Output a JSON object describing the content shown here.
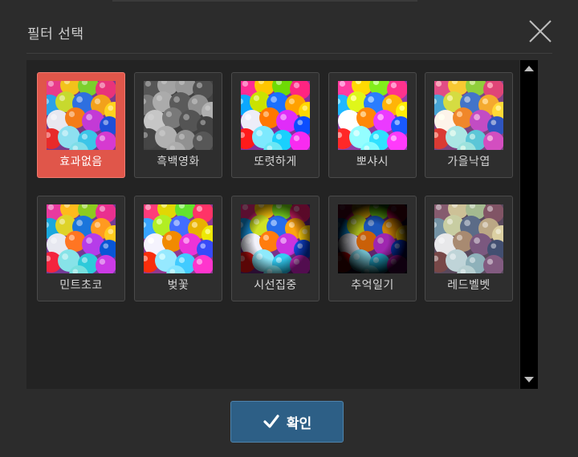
{
  "dialog": {
    "title": "필터 선택",
    "close_icon": "close-x-icon",
    "confirm_label": "확인",
    "confirm_icon": "checkmark-icon"
  },
  "filters": [
    {
      "label": "효과없음",
      "selected": true
    },
    {
      "label": "흑백영화",
      "selected": false
    },
    {
      "label": "또렷하게",
      "selected": false
    },
    {
      "label": "뽀샤시",
      "selected": false
    },
    {
      "label": "가을낙엽",
      "selected": false
    },
    {
      "label": "민트초코",
      "selected": false
    },
    {
      "label": "벚꽃",
      "selected": false
    },
    {
      "label": "시선집중",
      "selected": false
    },
    {
      "label": "추억일기",
      "selected": false
    },
    {
      "label": "레드벨벳",
      "selected": false
    }
  ],
  "colors": {
    "selected_tile": "#e0564a",
    "confirm_button": "#2d5f86"
  }
}
